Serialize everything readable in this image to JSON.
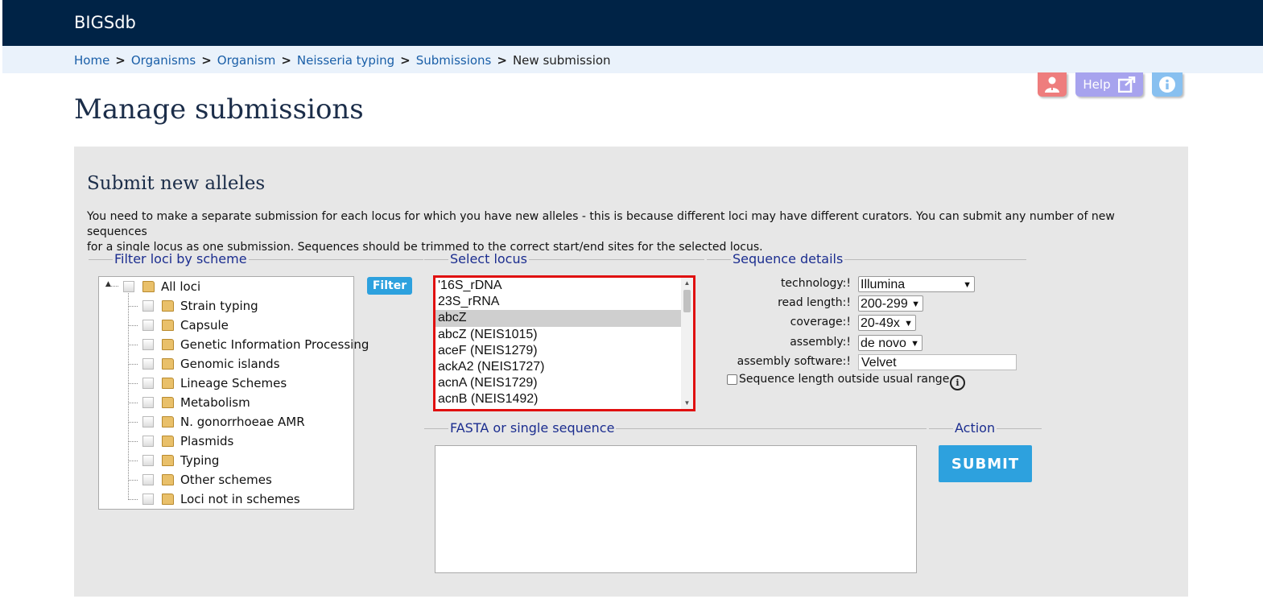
{
  "app": {
    "brand": "BIGSdb"
  },
  "breadcrumb": {
    "items": [
      "Home",
      "Organisms",
      "Organism",
      "Neisseria typing",
      "Submissions"
    ],
    "current": "New submission",
    "separator": ">"
  },
  "toolbar": {
    "help_label": "Help"
  },
  "page": {
    "title": "Manage submissions"
  },
  "panel": {
    "title": "Submit new alleles",
    "intro_line1": "You need to make a separate submission for each locus for which you have new alleles - this is because different loci may have different curators. You can submit any number of new sequences",
    "intro_line2": "for a single locus as one submission. Sequences should be trimmed to the correct start/end sites for the selected locus."
  },
  "filter": {
    "legend": "Filter loci by scheme",
    "button_label": "Filter",
    "root": "All loci",
    "schemes": [
      "Strain typing",
      "Capsule",
      "Genetic Information Processing",
      "Genomic islands",
      "Lineage Schemes",
      "Metabolism",
      "N. gonorrhoeae AMR",
      "Plasmids",
      "Typing",
      "Other schemes",
      "Loci not in schemes"
    ]
  },
  "locus": {
    "legend": "Select locus",
    "options": [
      "'16S_rDNA",
      "23S_rRNA",
      "abcZ",
      "abcZ (NEIS1015)",
      "aceF (NEIS1279)",
      "ackA2 (NEIS1727)",
      "acnA (NEIS1729)",
      "acnB (NEIS1492)"
    ],
    "selected": "abcZ"
  },
  "sequence_details": {
    "legend": "Sequence details",
    "technology_label": "technology:!",
    "technology_value": "Illumina",
    "read_length_label": "read length:!",
    "read_length_value": "200-299",
    "coverage_label": "coverage:!",
    "coverage_value": "20-49x",
    "assembly_label": "assembly:!",
    "assembly_value": "de novo",
    "software_label": "assembly software:!",
    "software_value": "Velvet",
    "outside_range_label": "Sequence length outside usual range",
    "info_glyph": "i"
  },
  "fasta": {
    "legend": "FASTA or single sequence",
    "value": ""
  },
  "action": {
    "legend": "Action",
    "submit_label": "SUBMIT"
  },
  "colors": {
    "header": "#002346",
    "crumbbar": "#eaf2fb",
    "accent": "#2da1de",
    "highlight": "#e01010"
  }
}
